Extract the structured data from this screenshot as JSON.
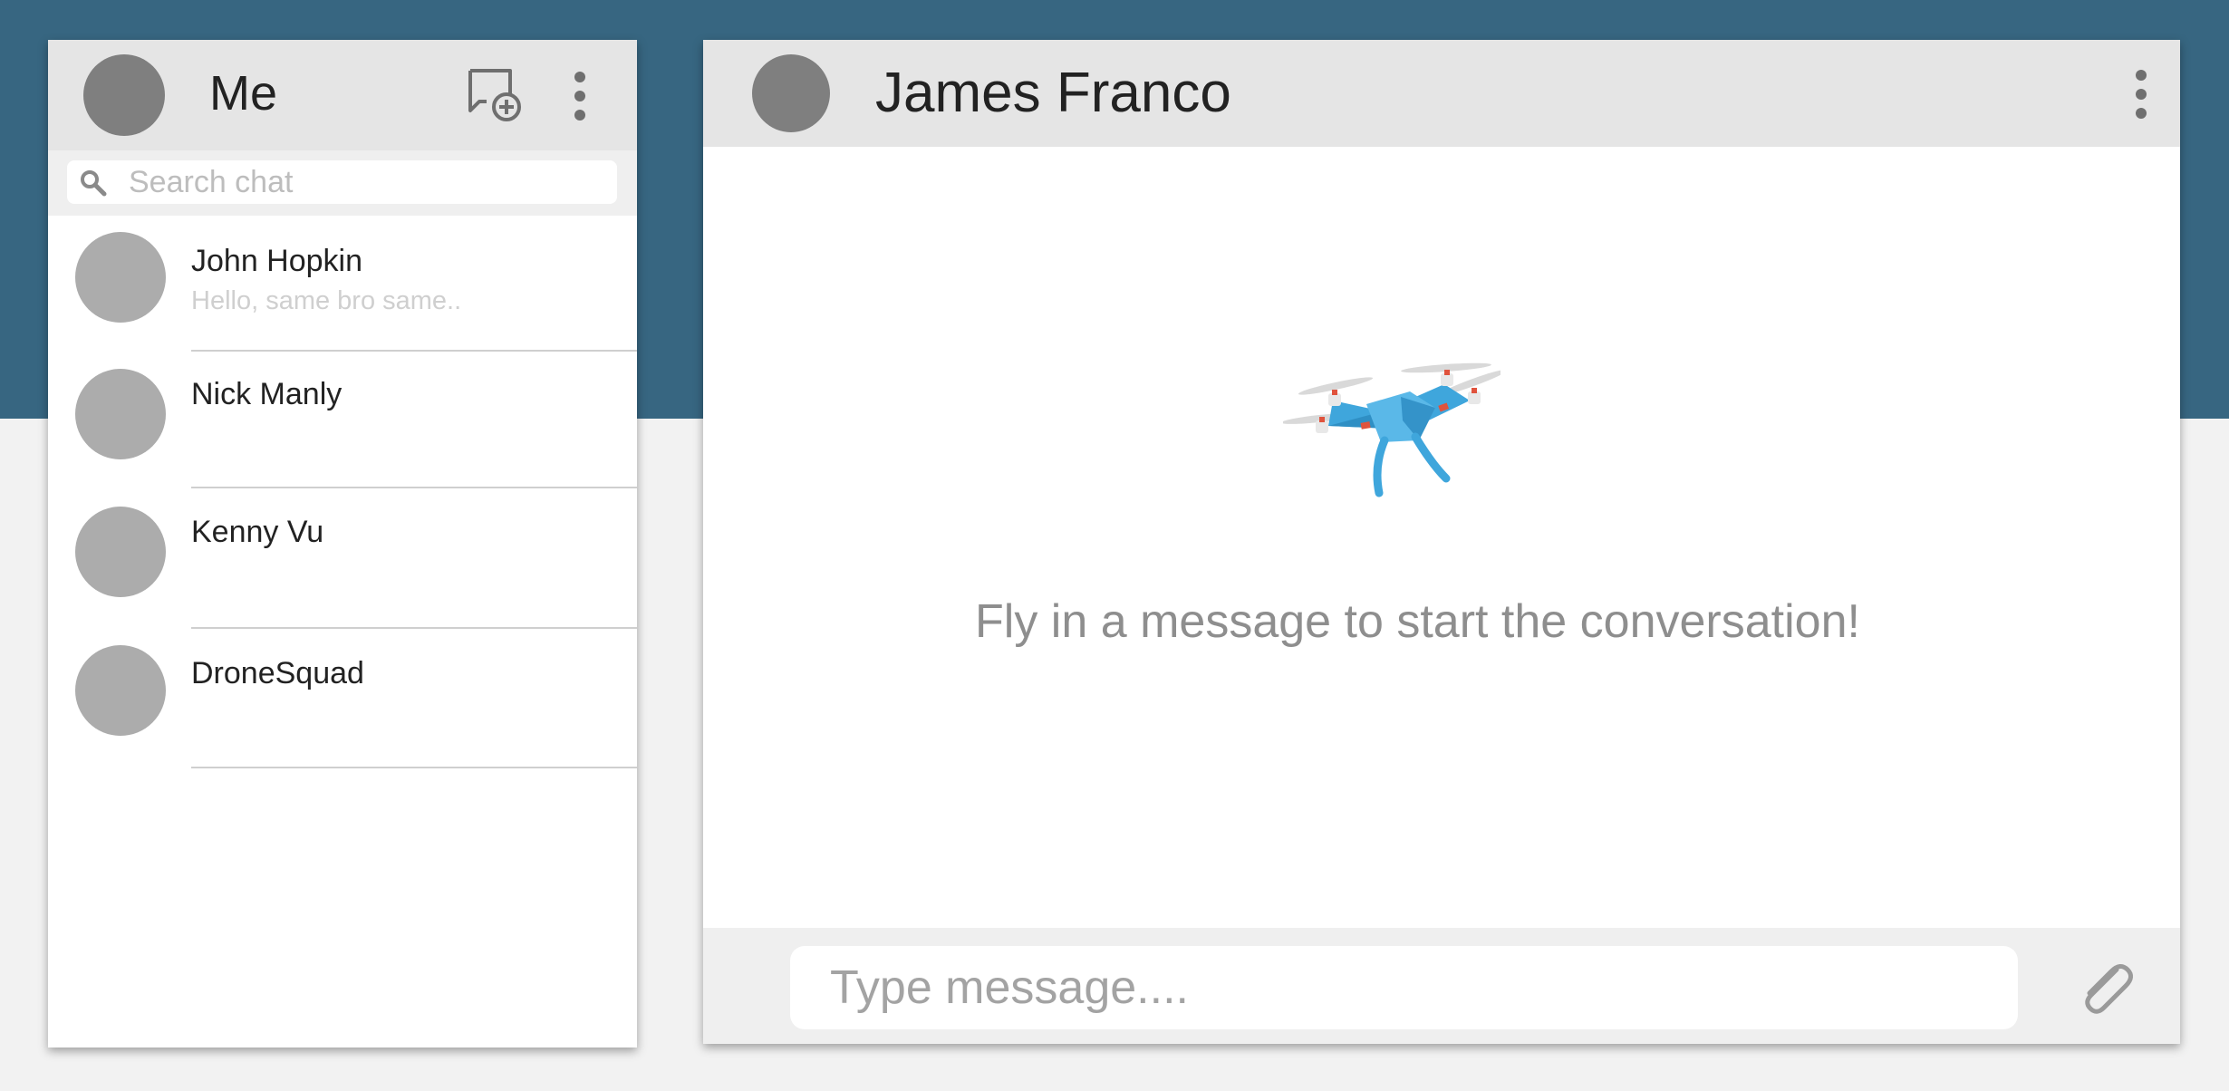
{
  "sidebar": {
    "user_name": "Me",
    "new_chat_icon": "new-chat-icon",
    "menu_icon": "more-vert-icon",
    "search": {
      "placeholder": "Search chat",
      "value": "",
      "icon": "search-icon"
    },
    "contacts": [
      {
        "name": "John Hopkin",
        "preview": "Hello, same bro same.."
      },
      {
        "name": "Nick Manly",
        "preview": ""
      },
      {
        "name": "Kenny Vu",
        "preview": ""
      },
      {
        "name": "DroneSquad",
        "preview": ""
      }
    ]
  },
  "chat": {
    "peer_name": "James Franco",
    "menu_icon": "more-vert-icon",
    "empty_state": {
      "illustration": "drone-icon",
      "text": "Fly in a message to start the conversation!"
    },
    "composer": {
      "placeholder": "Type message....",
      "value": "",
      "attach_icon": "paperclip-icon"
    }
  },
  "colors": {
    "header_band": "#376681",
    "panel_header": "#e5e5e5",
    "avatar_dark": "#7f7f7f",
    "avatar_light": "#acacac",
    "drone_blue": "#45a9dd"
  }
}
